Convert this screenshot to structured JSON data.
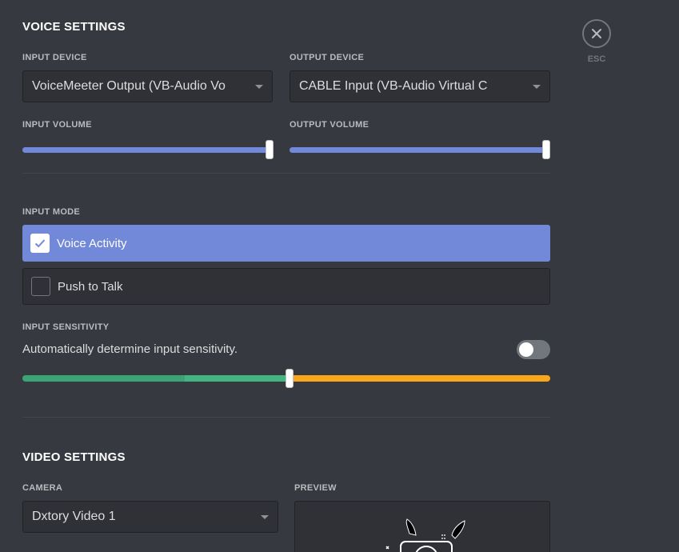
{
  "voice": {
    "section_title": "VOICE SETTINGS",
    "input_device": {
      "label": "INPUT DEVICE",
      "value": "VoiceMeeter Output (VB-Audio Vo"
    },
    "output_device": {
      "label": "OUTPUT DEVICE",
      "value": "CABLE Input (VB-Audio Virtual C"
    },
    "input_volume": {
      "label": "INPUT VOLUME",
      "level": 1.0
    },
    "output_volume": {
      "label": "OUTPUT VOLUME",
      "level": 1.0
    },
    "input_mode": {
      "label": "INPUT MODE",
      "options": [
        {
          "label": "Voice Activity",
          "selected": true
        },
        {
          "label": "Push to Talk",
          "selected": false
        }
      ]
    },
    "input_sensitivity": {
      "label": "INPUT SENSITIVITY",
      "auto_label": "Automatically determine input sensitivity.",
      "auto_enabled": false,
      "level": 0.506,
      "activity_level": 0.307
    }
  },
  "video": {
    "section_title": "VIDEO SETTINGS",
    "camera": {
      "label": "CAMERA",
      "value": "Dxtory Video 1"
    },
    "preview": {
      "label": "PREVIEW"
    }
  },
  "close": {
    "label": "ESC",
    "icon": "close-icon"
  },
  "colors": {
    "accent": "#7289da",
    "sens_active": "#43b581",
    "sens_active_dark": "#3ca374",
    "sens_inactive": "#faa61a"
  }
}
